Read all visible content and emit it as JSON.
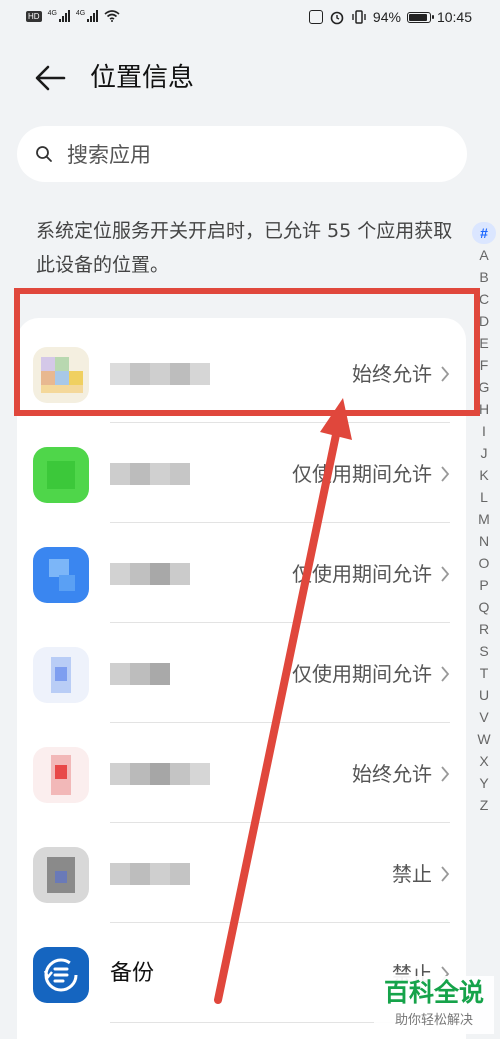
{
  "status_bar": {
    "hd_badge": "HD",
    "network_1": "4G",
    "network_2": "4G",
    "battery": "94%",
    "battery_level": 0.94,
    "time": "10:45"
  },
  "header": {
    "title": "位置信息"
  },
  "search": {
    "placeholder": "搜索应用",
    "value": ""
  },
  "description": "系统定位服务开关开启时，已允许 55 个应用获取此设备的位置。",
  "apps": [
    {
      "name": "",
      "permission": "始终允许",
      "icon": "blurred-app-icon"
    },
    {
      "name": "",
      "permission": "仅使用期间允许",
      "icon": "blurred-app-icon"
    },
    {
      "name": "",
      "permission": "仅使用期间允许",
      "icon": "blurred-app-icon"
    },
    {
      "name": "",
      "permission": "仅使用期间允许",
      "icon": "blurred-app-icon"
    },
    {
      "name": "",
      "permission": "始终允许",
      "icon": "blurred-app-icon"
    },
    {
      "name": "",
      "permission": "禁止",
      "icon": "blurred-app-icon"
    },
    {
      "name": "备份",
      "permission": "禁止",
      "icon": "backup-icon"
    }
  ],
  "index_letters": [
    "#",
    "A",
    "B",
    "C",
    "D",
    "E",
    "F",
    "G",
    "H",
    "I",
    "J",
    "K",
    "L",
    "M",
    "N",
    "O",
    "P",
    "Q",
    "R",
    "S",
    "T",
    "U",
    "V",
    "W",
    "X",
    "Y",
    "Z"
  ],
  "watermark": {
    "main": "百科全说",
    "sub": "助你轻松解决"
  },
  "colors": {
    "accent": "#1a66ff",
    "annotation": "#e0473c",
    "watermark": "#16a34a"
  }
}
